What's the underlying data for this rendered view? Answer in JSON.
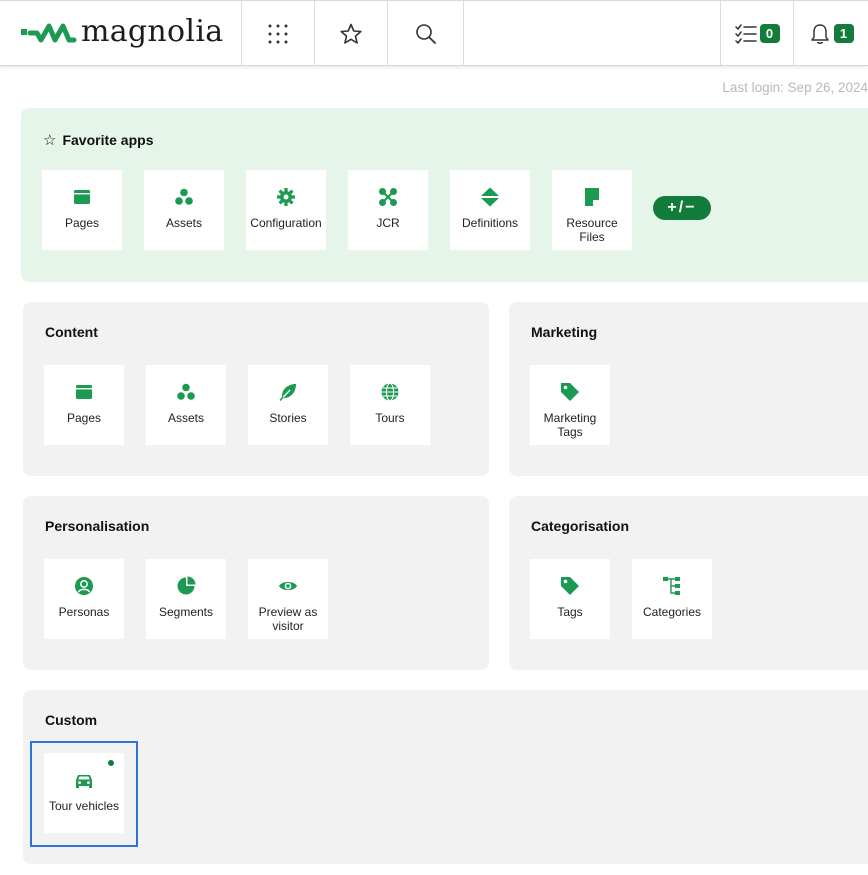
{
  "brand": {
    "name": "magnolia"
  },
  "colors": {
    "accent": "#137c3b",
    "icon_green": "#1c9a52",
    "fav_bg": "#e6f5e9",
    "panel_bg": "#f2f2f2",
    "selection": "#2e72d2"
  },
  "header": {
    "apps_icon": "grid-dots-icon",
    "favorites_icon": "star-icon",
    "search_icon": "search-icon",
    "tasks": {
      "icon": "tasklist-icon",
      "count": "0"
    },
    "notifications": {
      "icon": "bell-icon",
      "count": "1"
    }
  },
  "last_login": "Last login: Sep 26, 2024",
  "favorites": {
    "title": "Favorite apps",
    "apps": [
      {
        "label": "Pages",
        "icon": "pages-icon"
      },
      {
        "label": "Assets",
        "icon": "assets-icon"
      },
      {
        "label": "Configuration",
        "icon": "gear-icon"
      },
      {
        "label": "JCR",
        "icon": "jcr-icon"
      },
      {
        "label": "Definitions",
        "icon": "definitions-icon"
      },
      {
        "label": "Resource Files",
        "icon": "resource-file-icon"
      }
    ],
    "edit_label": "+/−"
  },
  "groups": {
    "content": {
      "title": "Content",
      "apps": [
        {
          "label": "Pages",
          "icon": "pages-icon"
        },
        {
          "label": "Assets",
          "icon": "assets-icon"
        },
        {
          "label": "Stories",
          "icon": "feather-icon"
        },
        {
          "label": "Tours",
          "icon": "globe-icon"
        }
      ]
    },
    "marketing": {
      "title": "Marketing",
      "apps": [
        {
          "label": "Marketing Tags",
          "icon": "tag-icon"
        }
      ]
    },
    "personalisation": {
      "title": "Personalisation",
      "apps": [
        {
          "label": "Personas",
          "icon": "persona-icon"
        },
        {
          "label": "Segments",
          "icon": "pie-chart-icon"
        },
        {
          "label": "Preview as visitor",
          "icon": "eye-icon"
        }
      ]
    },
    "categorisation": {
      "title": "Categorisation",
      "apps": [
        {
          "label": "Tags",
          "icon": "tag-icon"
        },
        {
          "label": "Categories",
          "icon": "tree-icon"
        }
      ]
    },
    "custom": {
      "title": "Custom",
      "apps": [
        {
          "label": "Tour vehicles",
          "icon": "car-icon"
        }
      ]
    }
  }
}
